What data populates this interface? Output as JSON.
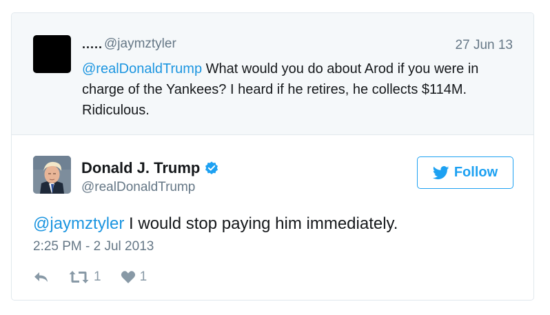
{
  "parent_tweet": {
    "name": ".....",
    "handle": "@jaymztyler",
    "date": "27 Jun 13",
    "mention": "@realDonaldTrump",
    "text": " What would you do about Arod if you were in charge of the Yankees? I heard if he retires, he collects $114M. Ridiculous."
  },
  "tweet": {
    "name": "Donald J. Trump",
    "handle": "@realDonaldTrump",
    "verified_icon": "verified-badge-icon",
    "follow_label": "Follow",
    "mention": "@jaymztyler",
    "text": " I would stop paying him immediately.",
    "timestamp": "2:25 PM - 2 Jul 2013",
    "retweets": "1",
    "likes": "1"
  },
  "colors": {
    "link": "#1b95e0",
    "follow": "#1da1f2",
    "muted": "#657786",
    "parent_bg": "#f5f8fa"
  }
}
